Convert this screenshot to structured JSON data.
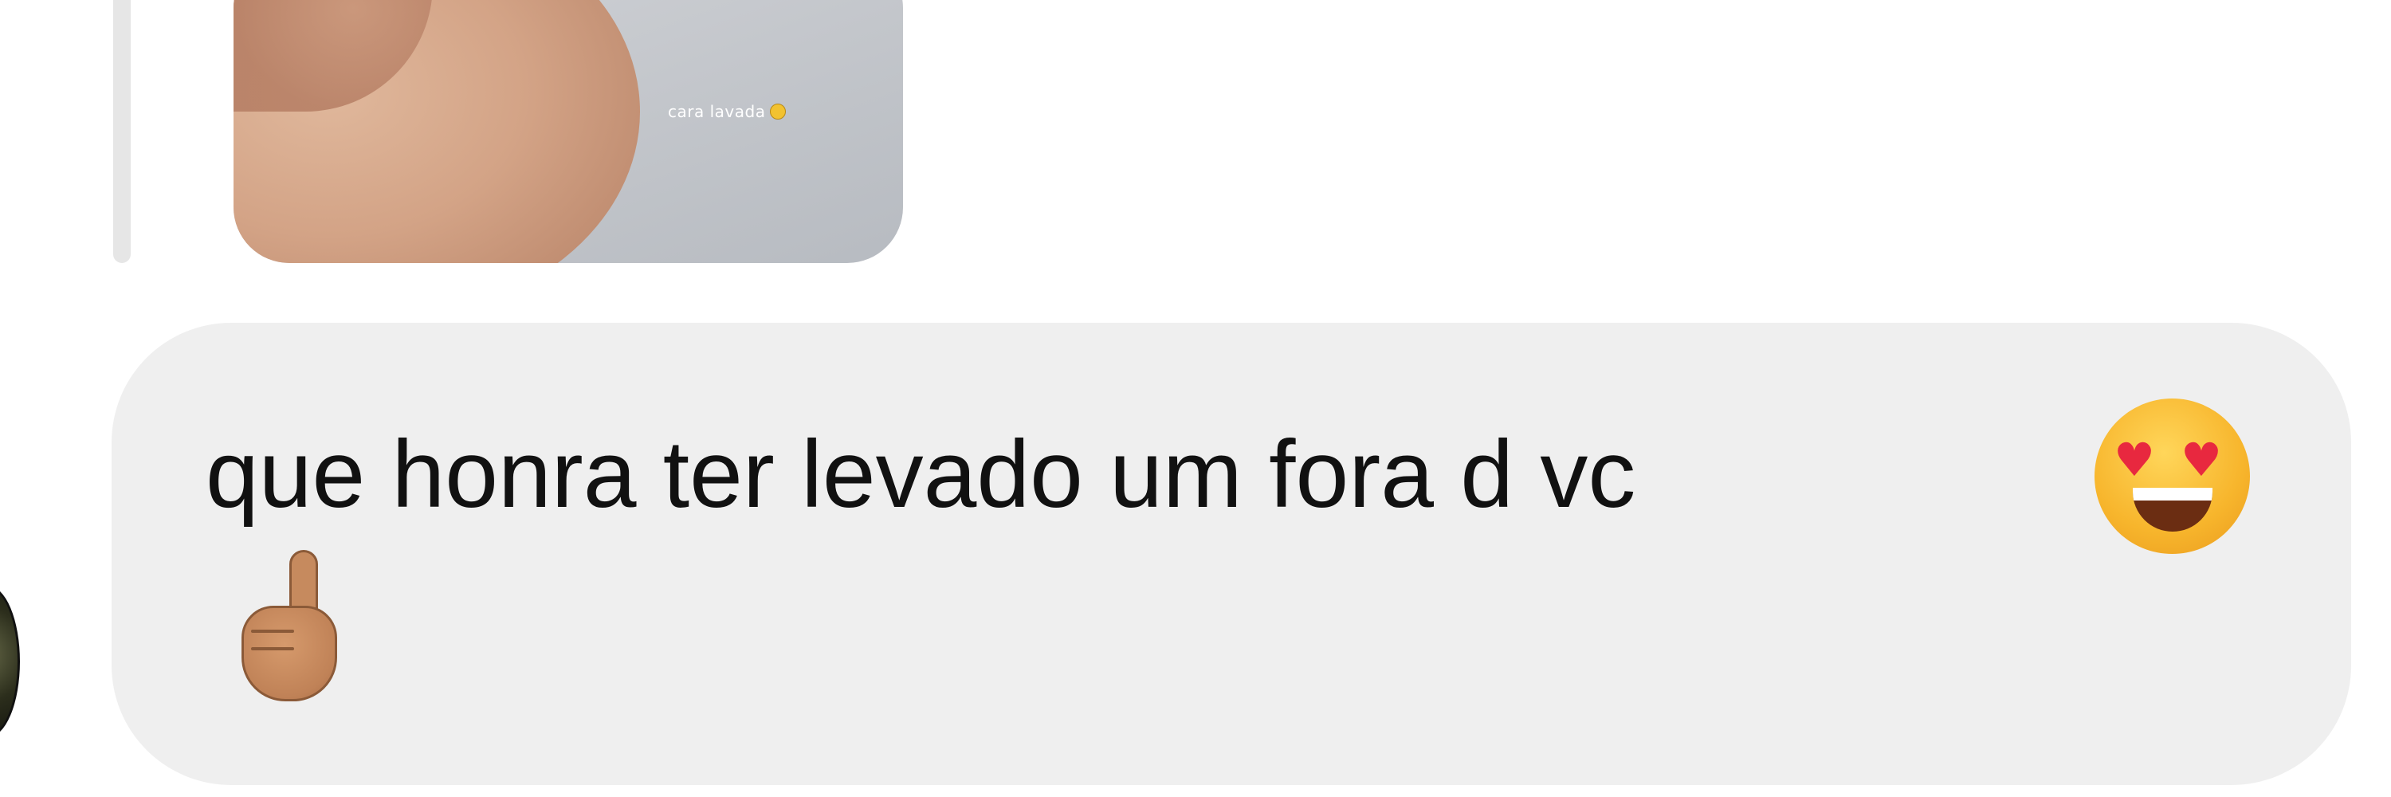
{
  "story_reply": {
    "caption": "cara lavada",
    "caption_emoji_icon": "cowboy-face-icon"
  },
  "message": {
    "text": "que honra ter levado um fora d vc",
    "emojis": [
      "smiling-face-with-heart-eyes-icon",
      "pointing-up-icon"
    ]
  },
  "colors": {
    "background": "#ffffff",
    "bubble": "#efefef",
    "reply_bar": "#e6e6e6",
    "text": "#111111"
  }
}
